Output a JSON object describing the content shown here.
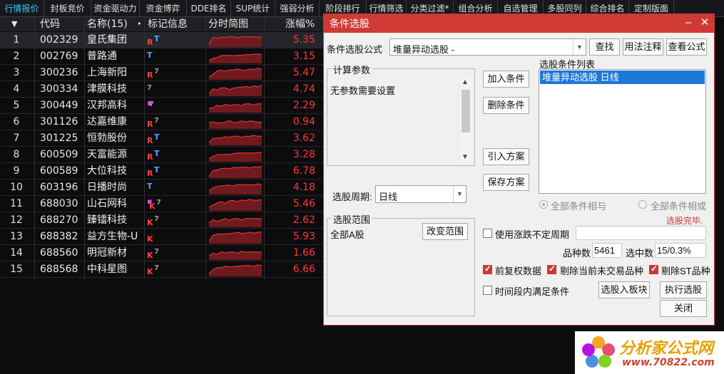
{
  "tabs": [
    {
      "label": "行情报价",
      "active": true
    },
    {
      "label": "封板竞价"
    },
    {
      "label": "资金驱动力"
    },
    {
      "label": "资金博弈"
    },
    {
      "label": "DDE排名"
    },
    {
      "label": "SUP统计"
    },
    {
      "label": "强弱分析"
    },
    {
      "label": "阶段排行"
    },
    {
      "label": "行情筛选"
    },
    {
      "label": "分类过滤*"
    },
    {
      "label": "组合分析"
    },
    {
      "label": "自选管理"
    },
    {
      "label": "多股同列"
    },
    {
      "label": "综合排名"
    },
    {
      "label": "定制版面"
    }
  ],
  "table": {
    "headers": {
      "sort": "▼",
      "code": "代码",
      "name": "名称(15)",
      "name_dot": "•",
      "mark": "标记信息",
      "chart": "分时简图",
      "chg": "涨幅%"
    },
    "rows": [
      {
        "idx": "1",
        "code": "002329",
        "name": "皇氏集团",
        "marks": [
          "R",
          "T"
        ],
        "chg": "5.35"
      },
      {
        "idx": "2",
        "code": "002769",
        "name": "普路通",
        "marks": [
          "T"
        ],
        "chg": "3.15"
      },
      {
        "idx": "3",
        "code": "300236",
        "name": "上海新阳",
        "marks": [
          "R",
          "7"
        ],
        "chg": "5.47"
      },
      {
        "idx": "4",
        "code": "300334",
        "name": "津膜科技",
        "marks": [
          "7"
        ],
        "chg": "4.74"
      },
      {
        "idx": "5",
        "code": "300449",
        "name": "汉邦高科",
        "marks": [
          "dot",
          "7"
        ],
        "chg": "2.29"
      },
      {
        "idx": "6",
        "code": "301126",
        "name": "达嘉维康",
        "marks": [
          "R",
          "7"
        ],
        "chg": "0.94"
      },
      {
        "idx": "7",
        "code": "301225",
        "name": "恒勃股份",
        "marks": [
          "R",
          "T"
        ],
        "chg": "3.62"
      },
      {
        "idx": "8",
        "code": "600509",
        "name": "天富能源",
        "marks": [
          "R",
          "T"
        ],
        "chg": "3.28"
      },
      {
        "idx": "9",
        "code": "600589",
        "name": "大位科技",
        "marks": [
          "R",
          "T"
        ],
        "chg": "6.78"
      },
      {
        "idx": "10",
        "code": "603196",
        "name": "日播时尚",
        "marks": [
          "T"
        ],
        "chg": "4.18"
      },
      {
        "idx": "11",
        "code": "688030",
        "name": "山石网科",
        "marks": [
          "dot",
          "K",
          "7"
        ],
        "chg": "5.46"
      },
      {
        "idx": "12",
        "code": "688270",
        "name": "臻镭科技",
        "marks": [
          "K",
          "7"
        ],
        "chg": "2.62"
      },
      {
        "idx": "13",
        "code": "688382",
        "name": "益方生物-U",
        "marks": [
          "K"
        ],
        "chg": "5.93"
      },
      {
        "idx": "14",
        "code": "688560",
        "name": "明冠新材",
        "marks": [
          "K",
          "7"
        ],
        "chg": "1.66"
      },
      {
        "idx": "15",
        "code": "688568",
        "name": "中科星图",
        "marks": [
          "K",
          "7"
        ],
        "chg": "6.66"
      }
    ]
  },
  "dialog": {
    "title": "条件选股",
    "formula_label": "条件选股公式",
    "formula_value": "堆量异动选股  -",
    "btn_find": "查找",
    "btn_usage": "用法注释",
    "btn_view": "查看公式",
    "params_title": "计算参数",
    "params_text": "无参数需要设置",
    "period_label": "选股周期:",
    "period_value": "日线",
    "btn_add": "加入条件",
    "btn_delete": "删除条件",
    "btn_import": "引入方案",
    "btn_save": "保存方案",
    "cond_list_title": "选股条件列表",
    "cond_items": [
      "堆量异动选股  日线"
    ],
    "radio_and": "全部条件相与",
    "radio_or": "全部条件相或",
    "status": "选股完毕.",
    "scope_title": "选股范围",
    "scope_value": "全部A股",
    "btn_change_scope": "改变范围",
    "chk_uncertain": "使用涨跌不定周期",
    "count_label": "品种数",
    "count_value": "5461",
    "selected_label": "选中数",
    "selected_value": "15/0.3%",
    "chk_prev_adj": "前复权数据",
    "chk_remove_untraded": "剔除当前未交易品种",
    "chk_remove_st": "剔除ST品种",
    "chk_time_range": "时间段内满足条件",
    "btn_to_block": "选股入板块",
    "btn_execute": "执行选股",
    "btn_close": "关闭"
  },
  "watermark": {
    "line1": "分析家公式网",
    "line2": "www.70822.com"
  },
  "colors": {
    "accent": "#d03a34",
    "price_up": "#ff3838",
    "tab_active": "#39c6ff",
    "selection": "#1e78d8"
  }
}
